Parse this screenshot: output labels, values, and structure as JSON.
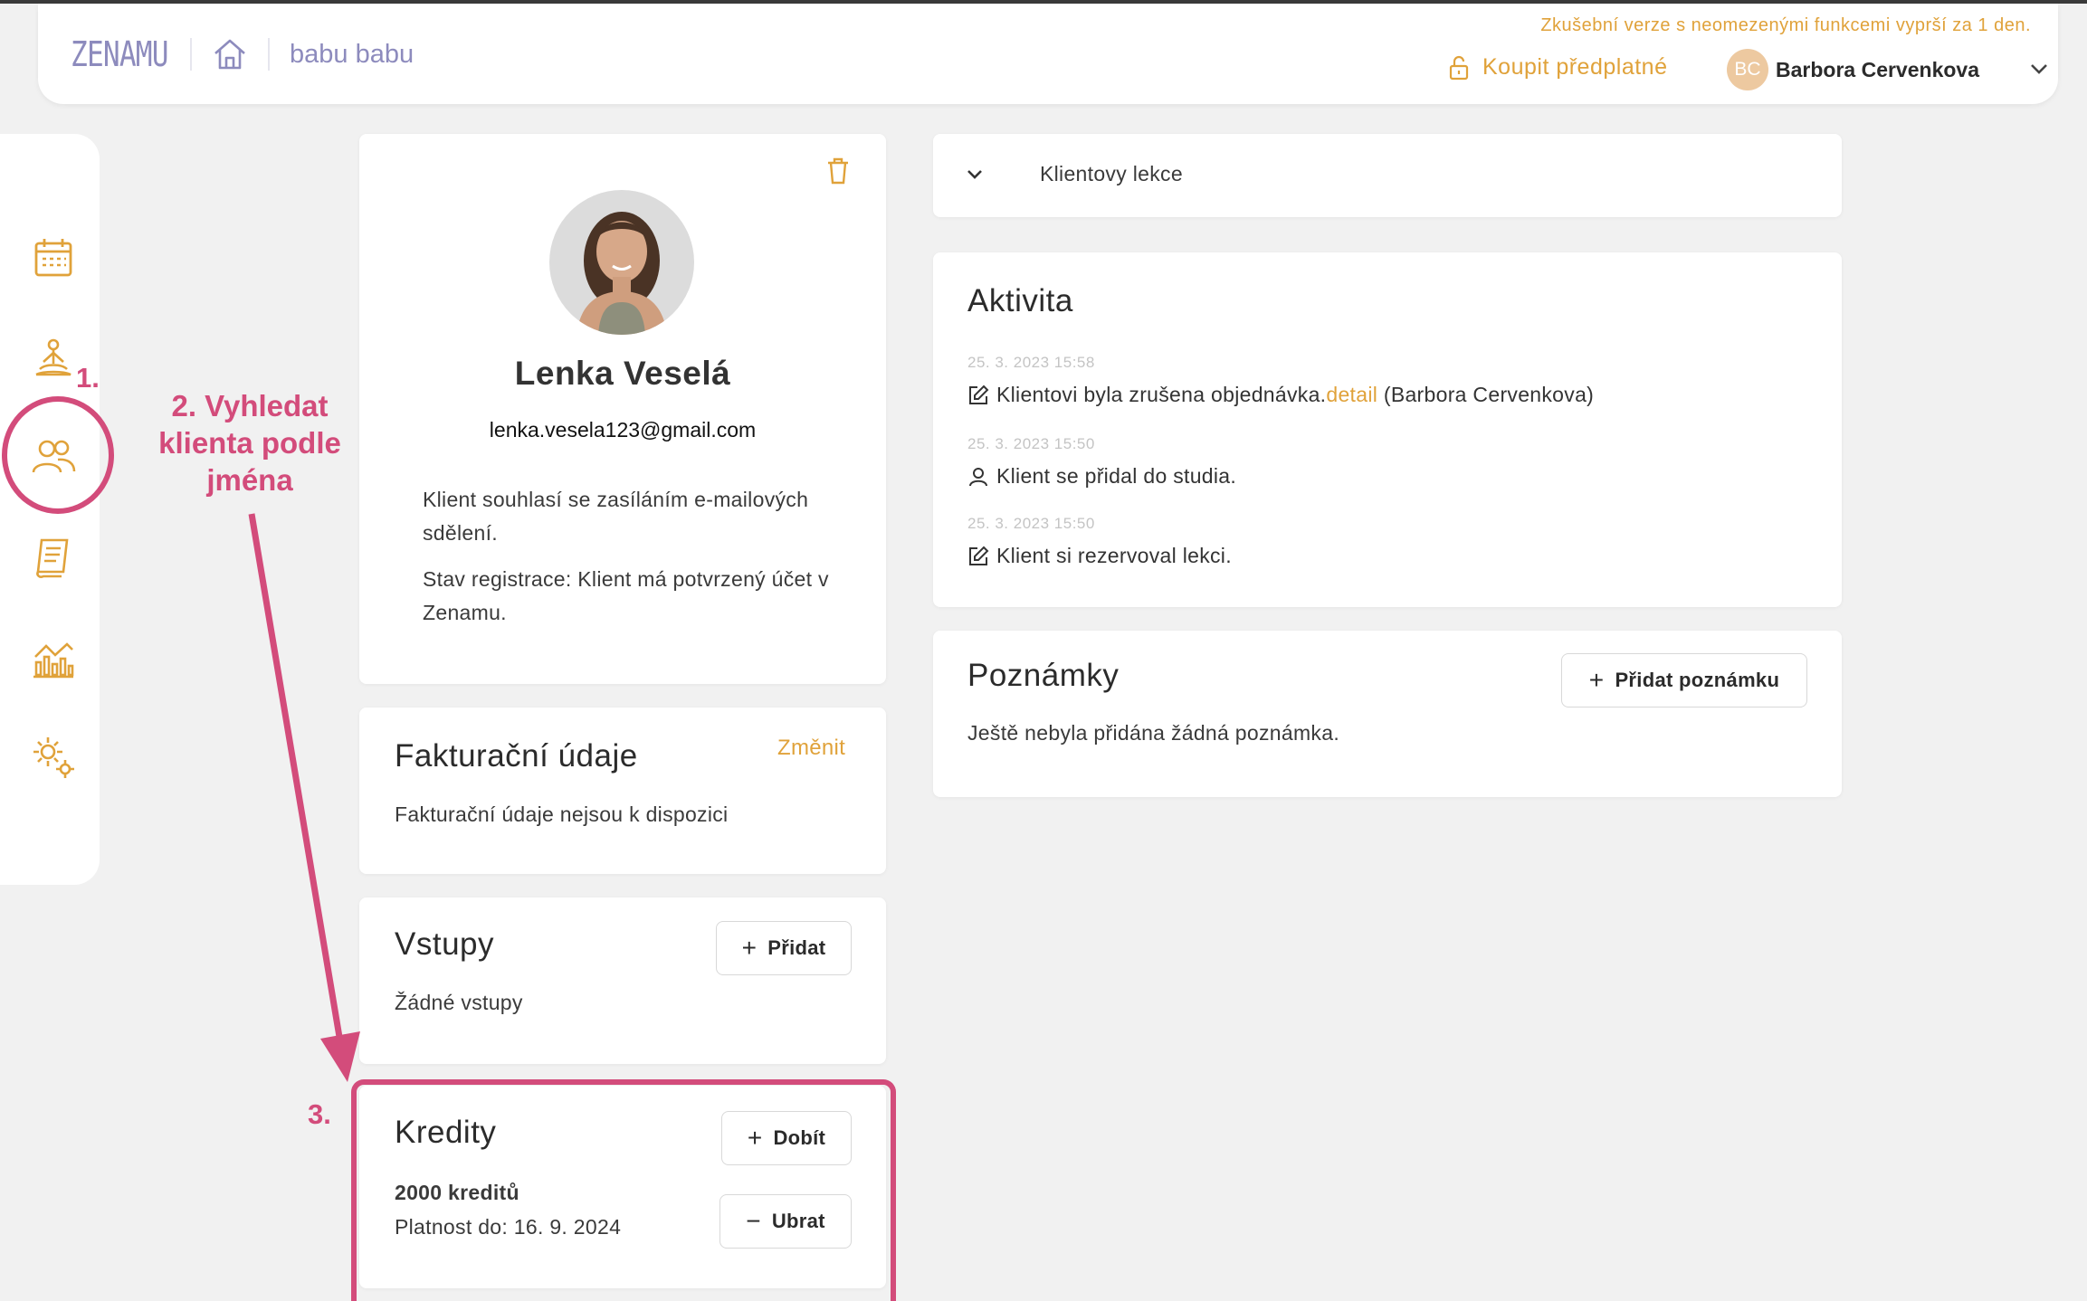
{
  "header": {
    "logo": "ZENAMU",
    "studio_name": "babu babu",
    "trial_message": "Zkušební verze s neomezenými funkcemi vyprší za 1 den.",
    "buy_label": "Koupit předplatné",
    "user_initials": "BC",
    "user_name": "Barbora Cervenkova"
  },
  "sidebar": {
    "items": [
      {
        "icon": "calendar-icon"
      },
      {
        "icon": "meditation-icon"
      },
      {
        "icon": "clients-icon"
      },
      {
        "icon": "invoice-icon"
      },
      {
        "icon": "chart-icon"
      },
      {
        "icon": "settings-icon"
      }
    ]
  },
  "profile": {
    "name": "Lenka Veselá",
    "email": "lenka.vesela123@gmail.com",
    "consent": "Klient souhlasí se zasíláním e-mailových sdělení.",
    "registration": "Stav registrace: Klient má potvrzený účet v Zenamu."
  },
  "billing": {
    "title": "Fakturační údaje",
    "change_label": "Změnit",
    "empty_text": "Fakturační údaje nejsou k dispozici"
  },
  "entries": {
    "title": "Vstupy",
    "add_label": "Přidat",
    "empty_text": "Žádné vstupy"
  },
  "credits": {
    "title": "Kredity",
    "topup_label": "Dobít",
    "remove_label": "Ubrat",
    "amount": "2000 kreditů",
    "validity": "Platnost do: 16. 9. 2024"
  },
  "lessons": {
    "title": "Klientovy lekce"
  },
  "activity": {
    "title": "Aktivita",
    "items": [
      {
        "date": "25. 3. 2023 15:58",
        "text": "Klientovi byla zrušena objednávka.",
        "link": "detail",
        "suffix": " (Barbora Cervenkova)"
      },
      {
        "date": "25. 3. 2023 15:50",
        "text": "Klient se přidal do studia."
      },
      {
        "date": "25. 3. 2023 15:50",
        "text": "Klient si rezervoval lekci."
      }
    ]
  },
  "notes": {
    "title": "Poznámky",
    "add_label": "Přidat poznámku",
    "empty_text": "Ještě nebyla přidána žádná poznámka."
  },
  "annotations": {
    "step1": "1.",
    "step2_line1": "2. Vyhledat",
    "step2_line2": "klienta podle",
    "step2_line3": "jména",
    "step3": "3.",
    "color": "#d34c7b"
  },
  "colors": {
    "accent": "#e0a23a",
    "logo": "#8d8bbd",
    "background": "#f1f1f1"
  }
}
